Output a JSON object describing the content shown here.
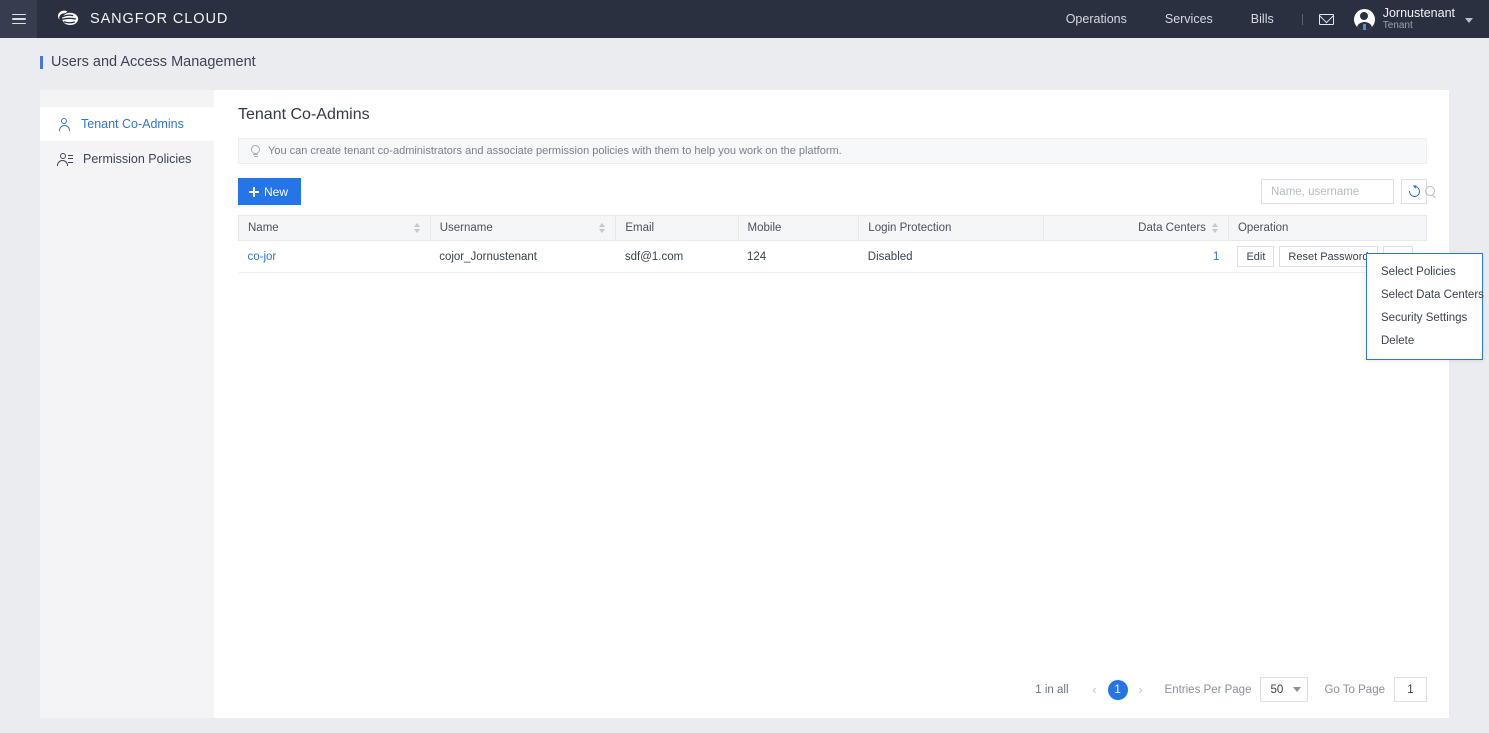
{
  "topbar": {
    "menu_icon": "hamburger-icon",
    "brand": "SANGFOR CLOUD",
    "nav": [
      {
        "label": "Operations"
      },
      {
        "label": "Services"
      },
      {
        "label": "Bills"
      }
    ],
    "mail_icon": "envelope-icon",
    "user": {
      "name": "Jornustenant",
      "role": "Tenant"
    }
  },
  "page": {
    "title": "Users and Access Management"
  },
  "sidebar": {
    "items": [
      {
        "label": "Tenant Co-Admins",
        "icon": "user-icon",
        "active": true
      },
      {
        "label": "Permission Policies",
        "icon": "user-list-icon",
        "active": false
      }
    ]
  },
  "main": {
    "heading": "Tenant Co-Admins",
    "notice": "You can create tenant co-administrators and associate permission policies with them to help you work on the platform.",
    "notice_icon": "lightbulb-icon",
    "new_button": "New",
    "search": {
      "placeholder": "Name, username",
      "value": "",
      "icon": "search-icon"
    },
    "refresh_icon": "refresh-icon"
  },
  "table": {
    "columns": [
      {
        "label": "Name",
        "sortable": true,
        "align": "left"
      },
      {
        "label": "Username",
        "sortable": true,
        "align": "left"
      },
      {
        "label": "Email",
        "sortable": false,
        "align": "left"
      },
      {
        "label": "Mobile",
        "sortable": false,
        "align": "left"
      },
      {
        "label": "Login Protection",
        "sortable": false,
        "align": "left"
      },
      {
        "label": "Data Centers",
        "sortable": true,
        "align": "right"
      },
      {
        "label": "Operation",
        "sortable": false,
        "align": "left"
      }
    ],
    "rows": [
      {
        "name": "co-jor",
        "username": "cojor_Jornustenant",
        "email": "sdf@1.com",
        "mobile": "124",
        "login_protection": "Disabled",
        "data_centers": "1",
        "operations": {
          "edit": "Edit",
          "reset_password": "Reset Password",
          "more": "···"
        }
      }
    ]
  },
  "dropdown": {
    "items": [
      {
        "label": "Select Policies"
      },
      {
        "label": "Select Data Centers"
      },
      {
        "label": "Security Settings"
      },
      {
        "label": "Delete"
      }
    ]
  },
  "pagination": {
    "total": "1 in all",
    "prev": "‹",
    "current_page": "1",
    "next": "›",
    "entries_label": "Entries Per Page",
    "entries_value": "50",
    "goto_label": "Go To Page",
    "goto_value": "1"
  },
  "colors": {
    "topbar_bg": "#2b3040",
    "accent": "#2574e8",
    "link": "#2f74dd",
    "page_bg": "#ebecf0"
  }
}
